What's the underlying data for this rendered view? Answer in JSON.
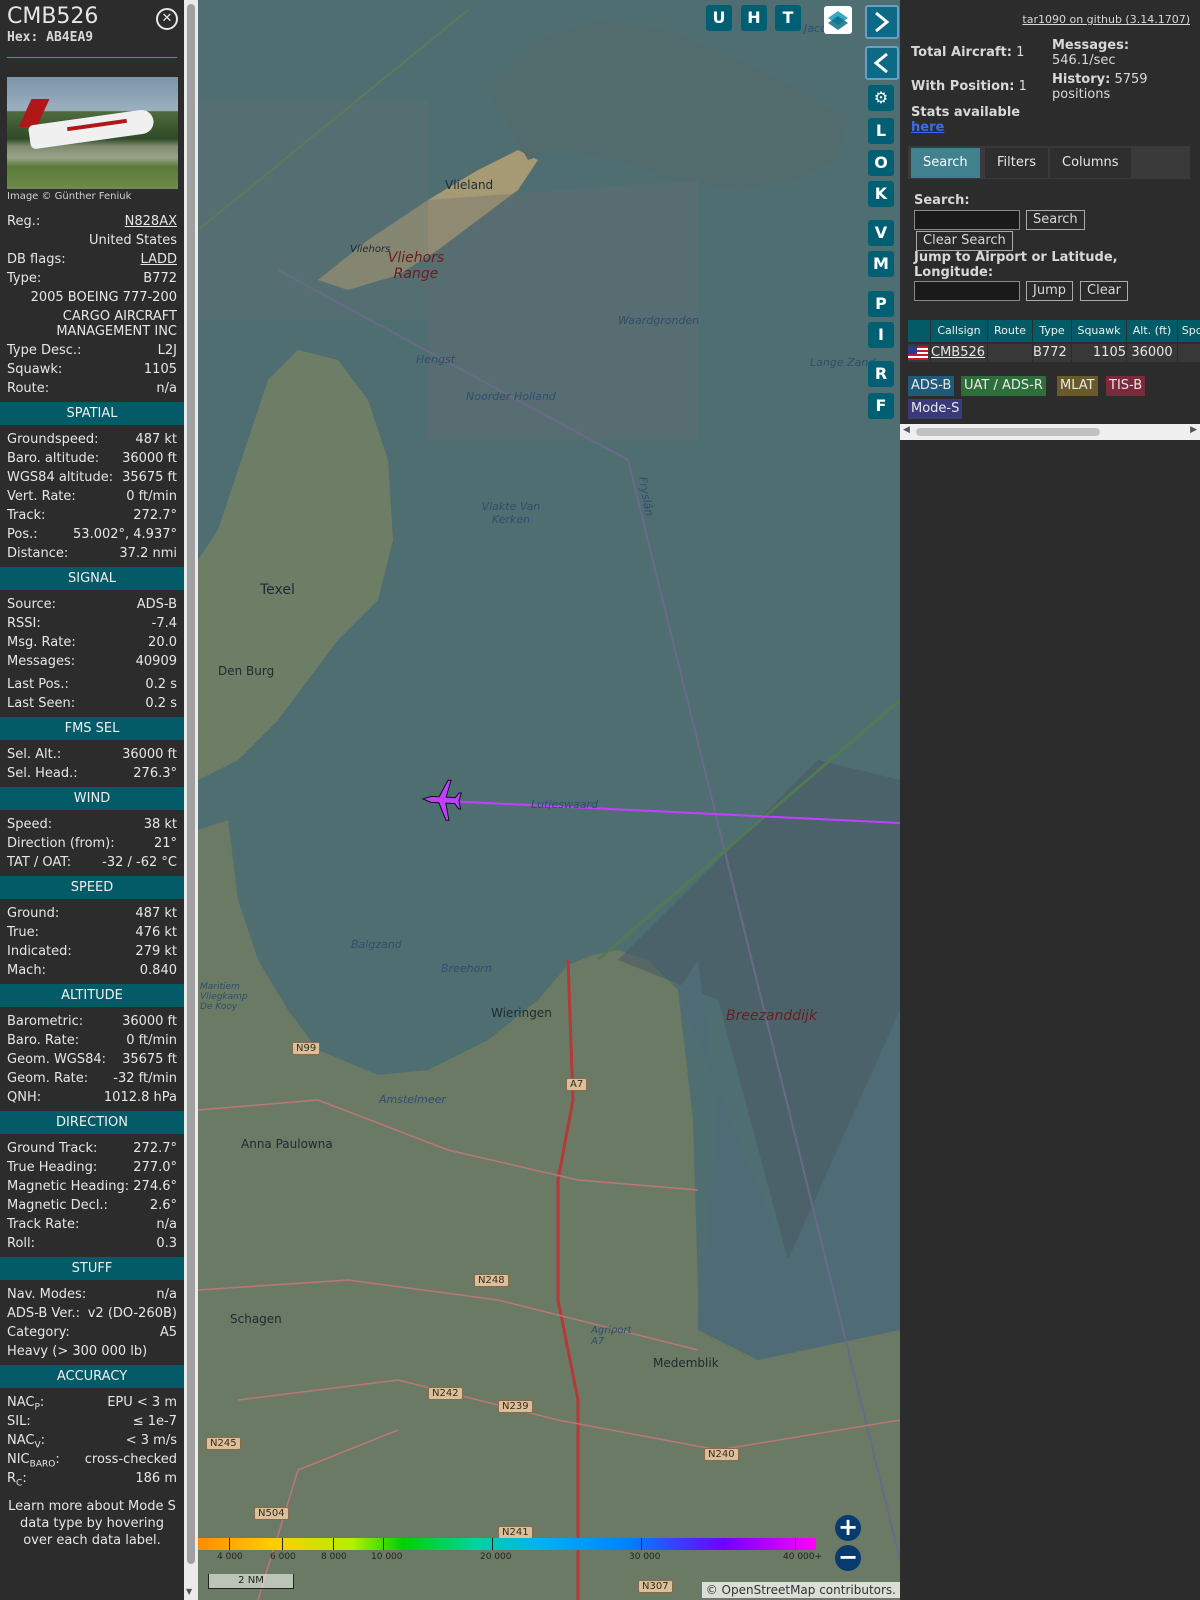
{
  "selected": {
    "callsign": "CMB526",
    "hex_label": "Hex:",
    "hex": "AB4EA9",
    "image_credit": "Image © Günther Feniuk",
    "fields": [
      {
        "label": "Reg.:",
        "value": "N828AX",
        "link": true
      },
      {
        "value_only": "United States"
      },
      {
        "label": "DB flags:",
        "value": "LADD",
        "link": true
      },
      {
        "label": "Type:",
        "value": "B772"
      },
      {
        "value_only": "2005 BOEING 777-200"
      },
      {
        "value_only": "CARGO AIRCRAFT MANAGEMENT INC"
      },
      {
        "label": "Type Desc.:",
        "value": "L2J"
      },
      {
        "label": "Squawk:",
        "value": "1105"
      },
      {
        "label": "Route:",
        "value": "n/a"
      }
    ],
    "sections": [
      {
        "title": "SPATIAL",
        "rows": [
          [
            "Groundspeed:",
            "487 kt"
          ],
          [
            "Baro. altitude:",
            "36000 ft"
          ],
          [
            "WGS84 altitude:",
            "35675 ft"
          ],
          [
            "Vert. Rate:",
            "0 ft/min"
          ],
          [
            "Track:",
            "272.7°"
          ],
          [
            "Pos.:",
            "53.002°, 4.937°"
          ],
          [
            "Distance:",
            "37.2 nmi"
          ]
        ]
      },
      {
        "title": "SIGNAL",
        "rows": [
          [
            "Source:",
            "ADS-B"
          ],
          [
            "RSSI:",
            "-7.4"
          ],
          [
            "Msg. Rate:",
            "20.0"
          ],
          [
            "Messages:",
            "40909"
          ],
          [
            "",
            ""
          ],
          [
            "Last Pos.:",
            "0.2 s"
          ],
          [
            "Last Seen:",
            "0.2 s"
          ]
        ]
      },
      {
        "title": "FMS SEL",
        "rows": [
          [
            "Sel. Alt.:",
            "36000 ft"
          ],
          [
            "Sel. Head.:",
            "276.3°"
          ]
        ]
      },
      {
        "title": "WIND",
        "rows": [
          [
            "Speed:",
            "38 kt"
          ],
          [
            "Direction (from):",
            "21°"
          ],
          [
            "TAT / OAT:",
            "-32 / -62 °C"
          ]
        ]
      },
      {
        "title": "SPEED",
        "rows": [
          [
            "Ground:",
            "487 kt"
          ],
          [
            "True:",
            "476 kt"
          ],
          [
            "Indicated:",
            "279 kt"
          ],
          [
            "Mach:",
            "0.840"
          ]
        ]
      },
      {
        "title": "ALTITUDE",
        "rows": [
          [
            "Barometric:",
            "36000 ft"
          ],
          [
            "Baro. Rate:",
            "0 ft/min"
          ],
          [
            "Geom. WGS84:",
            "35675 ft"
          ],
          [
            "Geom. Rate:",
            "-32 ft/min"
          ],
          [
            "QNH:",
            "1012.8 hPa"
          ]
        ]
      },
      {
        "title": "DIRECTION",
        "rows": [
          [
            "Ground Track:",
            "272.7°"
          ],
          [
            "True Heading:",
            "277.0°"
          ],
          [
            "Magnetic Heading:",
            "274.6°"
          ],
          [
            "Magnetic Decl.:",
            "2.6°"
          ],
          [
            "Track Rate:",
            "n/a"
          ],
          [
            "Roll:",
            "0.3"
          ]
        ]
      },
      {
        "title": "STUFF",
        "rows": [
          [
            "Nav. Modes:",
            "n/a"
          ],
          [
            "ADS-B Ver.:",
            "v2 (DO-260B)"
          ],
          [
            "Category:",
            "A5"
          ],
          [
            "Heavy (> 300 000 lb)",
            ""
          ]
        ]
      },
      {
        "title": "ACCURACY",
        "rows": [
          [
            "NACP:",
            "EPU < 3 m"
          ],
          [
            "SIL:",
            "≤ 1e-7"
          ],
          [
            "NACV:",
            "< 3 m/s"
          ],
          [
            "NICBARO:",
            "cross-checked"
          ],
          [
            "RC:",
            "186 m"
          ]
        ]
      }
    ],
    "learn_more": "Learn more about Mode S data type by hovering over each data label."
  },
  "map": {
    "buttons": [
      "U",
      "H",
      "T"
    ],
    "side_buttons": [
      "L",
      "O",
      "K",
      "V",
      "M",
      "P",
      "I",
      "R",
      "F"
    ],
    "labels": [
      {
        "text": "Vlieland",
        "style": "normal"
      },
      {
        "text": "Vliehors",
        "style": "small"
      },
      {
        "text": "Vliehors Range",
        "style": "range"
      },
      {
        "text": "Waardgronden",
        "style": "water"
      },
      {
        "text": "Hengst",
        "style": "water"
      },
      {
        "text": "Noorder Holland",
        "style": "water"
      },
      {
        "text": "Vlakte Van Kerken",
        "style": "water"
      },
      {
        "text": "Texel",
        "style": "big"
      },
      {
        "text": "Den Burg",
        "style": "normal"
      },
      {
        "text": "Lutjeswaard",
        "style": "water"
      },
      {
        "text": "Balgzand",
        "style": "water"
      },
      {
        "text": "Breehorn",
        "style": "water"
      },
      {
        "text": "Wieringen",
        "style": "normal"
      },
      {
        "text": "Breezanddijk",
        "style": "range"
      },
      {
        "text": "Maritiem Vliegkamp De Kooy",
        "style": "water"
      },
      {
        "text": "Amstelmeer",
        "style": "water"
      },
      {
        "text": "Anna Paulowna",
        "style": "normal"
      },
      {
        "text": "Schagen",
        "style": "normal"
      },
      {
        "text": "Agriport A7",
        "style": "water"
      },
      {
        "text": "Medemblik",
        "style": "normal"
      },
      {
        "text": "Lange Zand",
        "style": "water"
      },
      {
        "text": "Jacobs",
        "style": "water"
      },
      {
        "text": "Fryslân",
        "style": "water"
      }
    ],
    "road_badges": [
      "N99",
      "A7",
      "N248",
      "N242",
      "N239",
      "N245",
      "N240",
      "N504",
      "N241",
      "N307"
    ],
    "colorbar_ticks": [
      "4 000",
      "6 000",
      "8 000",
      "10 000",
      "20 000",
      "30 000",
      "40 000+"
    ],
    "scale": "2 NM",
    "attribution": "© OpenStreetMap contributors."
  },
  "panel": {
    "github": "tar1090 on github (3.14.1707)",
    "total_aircraft_label": "Total Aircraft:",
    "total_aircraft": "1",
    "with_position_label": "With Position:",
    "with_position": "1",
    "stats_label": "Stats available",
    "stats_link": "here",
    "messages_label": "Messages:",
    "messages": "546.1/sec",
    "history_label": "History:",
    "history": "5759 positions",
    "tabs": [
      "Search",
      "Filters",
      "Columns"
    ],
    "search_label": "Search:",
    "search_button": "Search",
    "clear_search_button": "Clear Search",
    "jump_label": "Jump to Airport or Latitude, Longitude:",
    "jump_button": "Jump",
    "clear_button": "Clear",
    "table": {
      "columns": [
        "",
        "Callsign",
        "Route",
        "Type",
        "Squawk",
        "Alt. (ft)",
        "Spd."
      ],
      "rows": [
        {
          "flag": "us-flag-icon",
          "callsign": "CMB526",
          "route": "",
          "type": "B772",
          "squawk": "1105",
          "alt": "36000",
          "spd": ""
        }
      ]
    },
    "source_pills": [
      {
        "label": "ADS-B",
        "color": "#1f5a7a"
      },
      {
        "label": "UAT / ADS-R",
        "color": "#2e6e3a"
      },
      {
        "label": "MLAT",
        "color": "#6a5a2a"
      },
      {
        "label": "TIS-B",
        "color": "#7a2a3a"
      },
      {
        "label": "Mode-S",
        "color": "#3a3a7a"
      }
    ]
  }
}
